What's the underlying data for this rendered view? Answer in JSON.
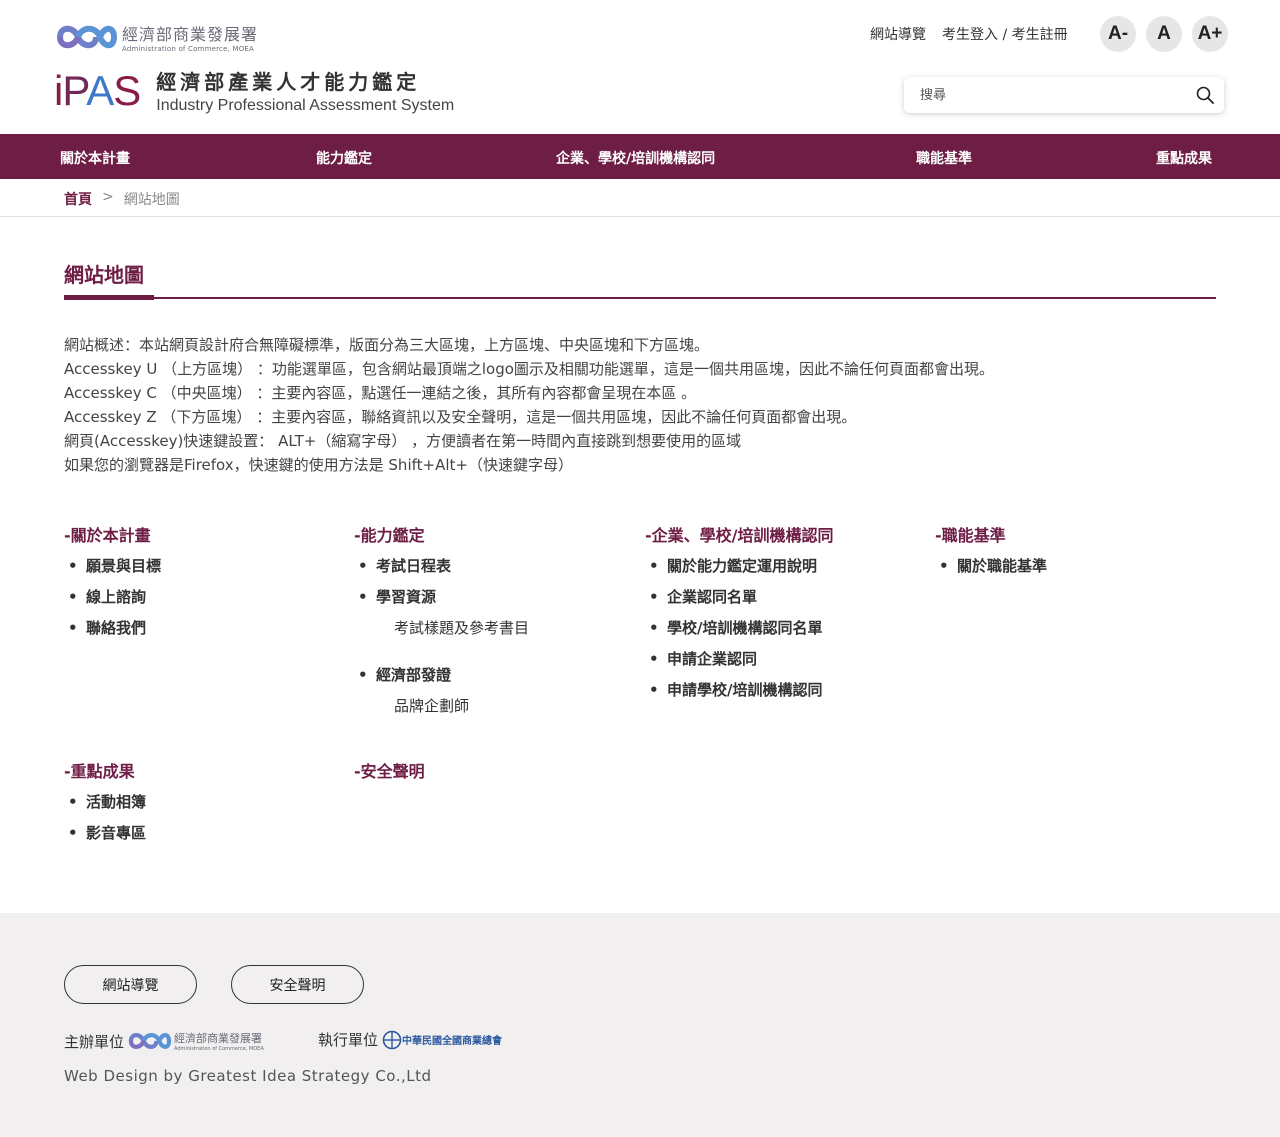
{
  "header": {
    "moea_name": "經濟部商業發展署",
    "moea_en": "Administration of Commerce, MOEA",
    "ipas_zh": "經濟部產業人才能力鑑定",
    "ipas_en": "Industry Professional Assessment System",
    "top_links": [
      "網站導覽",
      "考生登入 / 考生註冊"
    ],
    "font_buttons": [
      "A-",
      "A",
      "A+"
    ],
    "search_placeholder": "搜尋"
  },
  "nav": {
    "items": [
      "關於本計畫",
      "能力鑑定",
      "企業、學校/培訓機構認同",
      "職能基準",
      "重點成果"
    ]
  },
  "breadcrumb": {
    "home": "首頁",
    "separator": ">",
    "current": "網站地圖"
  },
  "page": {
    "title": "網站地圖",
    "intro": [
      "網站概述：本站網頁設計府合無障礙標準，版面分為三大區塊，上方區塊、中央區塊和下方區塊。",
      "Accesskey U （上方區塊） ：功能選單區，包含網站最頂端之logo圖示及相關功能選單，這是一個共用區塊，因此不論任何頁面都會出現。",
      "Accesskey C （中央區塊） ：主要內容區，點選任一連結之後，其所有內容都會呈現在本區 。",
      "Accesskey Z （下方區塊） ：主要內容區，聯絡資訊以及安全聲明，這是一個共用區塊，因此不論任何頁面都會出現。",
      "網頁(Accesskey)快速鍵設置： ALT+（縮寫字母） ，方便讀者在第一時間內直接跳到想要使用的區域",
      "如果您的瀏覽器是Firefox，快速鍵的使用方法是 Shift+Alt+（快速鍵字母）"
    ]
  },
  "sitemap": {
    "about": {
      "head": "-關於本計畫",
      "items": [
        "願景與目標",
        "線上諮詢",
        "聯絡我們"
      ]
    },
    "cert": {
      "head": "-能力鑑定",
      "items": [
        "考試日程表",
        "學習資源",
        "經濟部發證"
      ],
      "sub1": "考試樣題及參考書目",
      "sub2": "品牌企劃師"
    },
    "recog": {
      "head": "-企業、學校/培訓機構認同",
      "items": [
        "關於能力鑑定運用說明",
        "企業認同名單",
        "學校/培訓機構認同名單",
        "申請企業認同",
        "申請學校/培訓機構認同"
      ]
    },
    "standard": {
      "head": "-職能基準",
      "items": [
        "關於職能基準"
      ]
    },
    "results": {
      "head": "-重點成果",
      "items": [
        "活動相簿",
        "影音專區"
      ]
    },
    "security": {
      "head": "-安全聲明"
    }
  },
  "footer": {
    "buttons": [
      "網站導覽",
      "安全聲明"
    ],
    "organizer_label": "主辦單位",
    "organizer_name": "經濟部商業發展署",
    "organizer_en": "Administration of Commerce, MOEA",
    "executor_label": "執行單位",
    "executor_name": "中華民國全國商業總會",
    "webdesign": "Web Design by  Greatest Idea Strategy Co.,Ltd"
  },
  "colors": {
    "brand": "#6e1d44",
    "footer_bg": "#f1efef"
  }
}
